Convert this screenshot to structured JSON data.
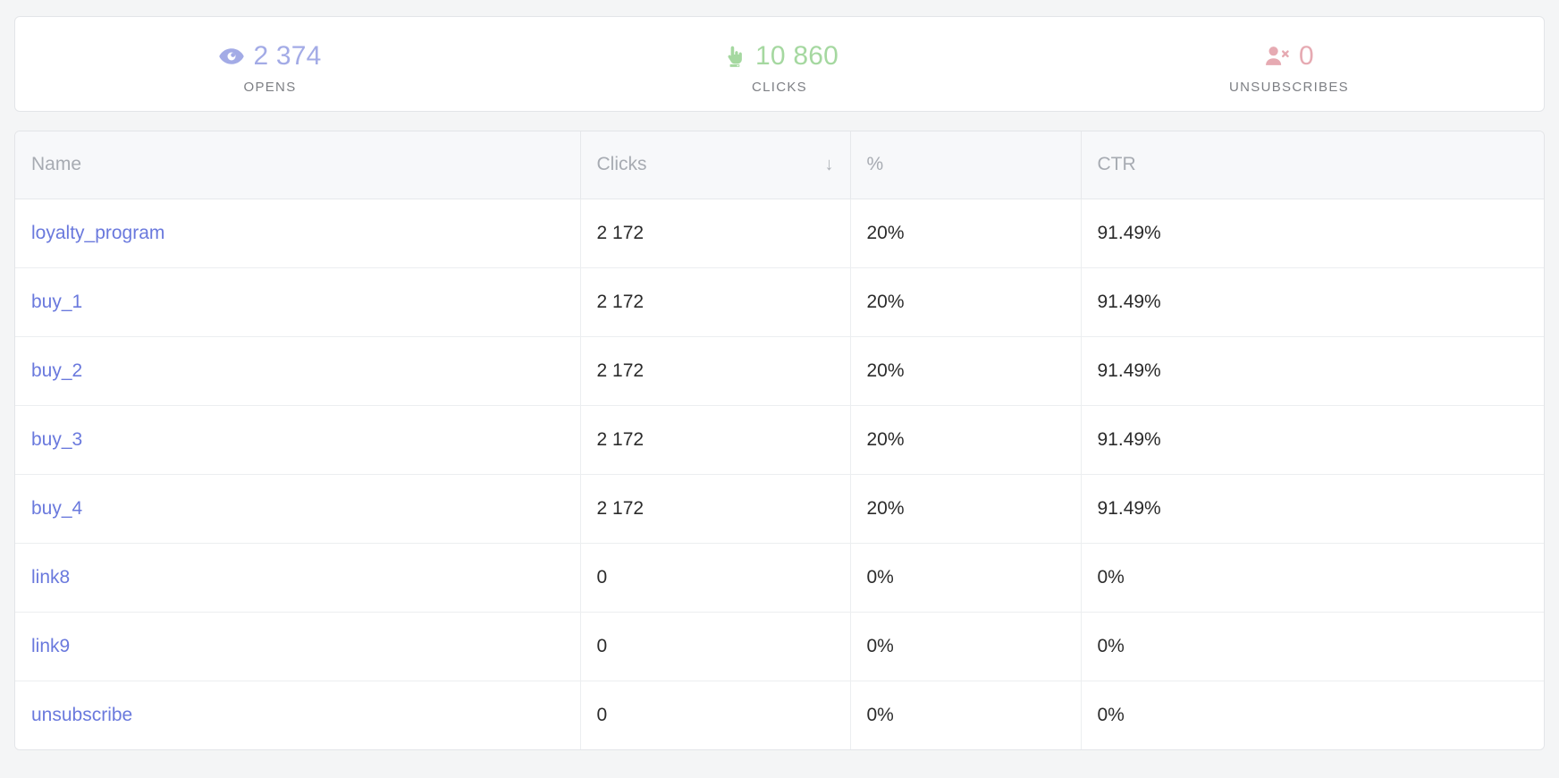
{
  "summary": {
    "stats": [
      {
        "icon": "eye-icon",
        "value": "2 374",
        "label": "OPENS",
        "color": "#a3abe6"
      },
      {
        "icon": "pointing-hand-icon",
        "value": "10 860",
        "label": "CLICKS",
        "color": "#a5d8a0"
      },
      {
        "icon": "user-remove-icon",
        "value": "0",
        "label": "UNSUBSCRIBES",
        "color": "#e6aab2"
      }
    ]
  },
  "table": {
    "columns": [
      {
        "label": "Name",
        "sorted": false
      },
      {
        "label": "Clicks",
        "sorted": true,
        "sort_arrow": "↓"
      },
      {
        "label": "%",
        "sorted": false
      },
      {
        "label": "CTR",
        "sorted": false
      }
    ],
    "rows": [
      {
        "name": "loyalty_program",
        "clicks": "2 172",
        "percent": "20%",
        "ctr": "91.49%"
      },
      {
        "name": "buy_1",
        "clicks": "2 172",
        "percent": "20%",
        "ctr": "91.49%"
      },
      {
        "name": "buy_2",
        "clicks": "2 172",
        "percent": "20%",
        "ctr": "91.49%"
      },
      {
        "name": "buy_3",
        "clicks": "2 172",
        "percent": "20%",
        "ctr": "91.49%"
      },
      {
        "name": "buy_4",
        "clicks": "2 172",
        "percent": "20%",
        "ctr": "91.49%"
      },
      {
        "name": "link8",
        "clicks": "0",
        "percent": "0%",
        "ctr": "0%"
      },
      {
        "name": "link9",
        "clicks": "0",
        "percent": "0%",
        "ctr": "0%"
      },
      {
        "name": "unsubscribe",
        "clicks": "0",
        "percent": "0%",
        "ctr": "0%"
      }
    ]
  },
  "colors": {
    "page_background": "#f4f5f6",
    "card_background": "#ffffff",
    "card_border": "#e3e5e8",
    "header_background": "#f7f8fa",
    "header_text": "#a7abb2",
    "link": "#6a79dd",
    "cell_text": "#2b2b2b",
    "label_text": "#7d7f84"
  }
}
